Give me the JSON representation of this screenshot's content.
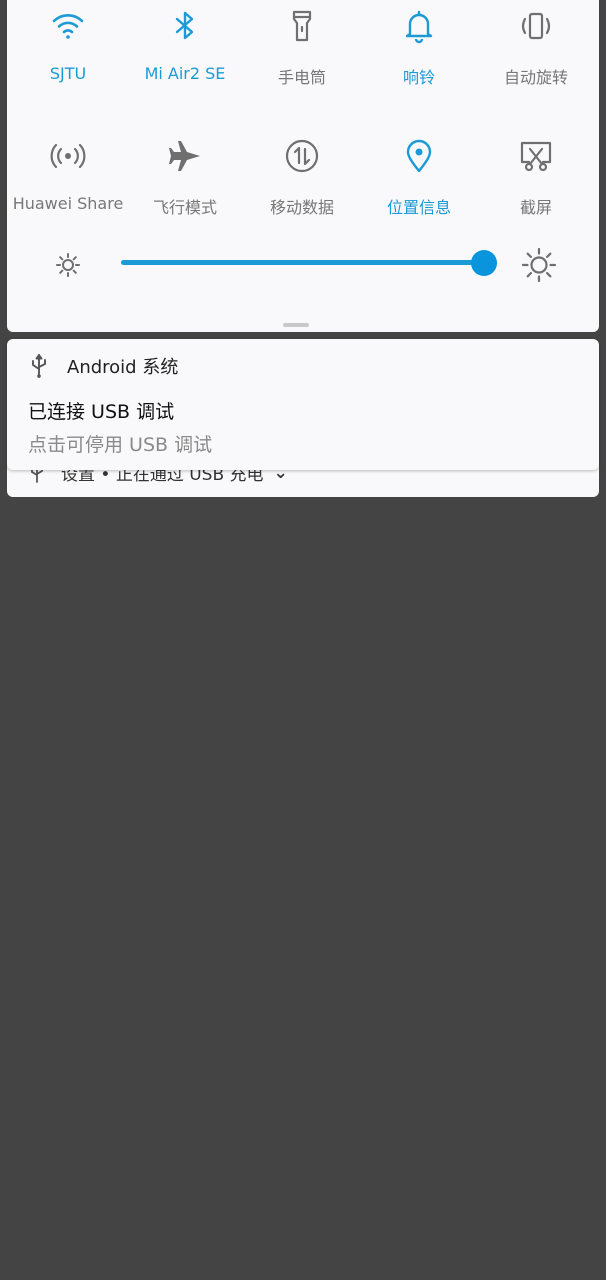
{
  "quick_settings": {
    "tiles": [
      {
        "id": "wifi",
        "label": "SJTU",
        "icon": "wifi-icon",
        "active": true
      },
      {
        "id": "bluetooth",
        "label": "Mi Air2 SE",
        "icon": "bluetooth-icon",
        "active": true
      },
      {
        "id": "flashlight",
        "label": "手电筒",
        "icon": "flashlight-icon",
        "active": false
      },
      {
        "id": "ring",
        "label": "响铃",
        "icon": "bell-icon",
        "active": true
      },
      {
        "id": "autorotate",
        "label": "自动旋转",
        "icon": "rotate-icon",
        "active": false
      },
      {
        "id": "huawei_share",
        "label": "Huawei Share",
        "icon": "share-icon",
        "active": false
      },
      {
        "id": "airplane",
        "label": "飞行模式",
        "icon": "airplane-icon",
        "active": false
      },
      {
        "id": "mobile_data",
        "label": "移动数据",
        "icon": "mobile-data-icon",
        "active": false
      },
      {
        "id": "location",
        "label": "位置信息",
        "icon": "location-icon",
        "active": true
      },
      {
        "id": "screenshot",
        "label": "截屏",
        "icon": "screenshot-icon",
        "active": false
      }
    ],
    "brightness_level": 0.97
  },
  "notification": {
    "app_name": "Android 系统",
    "title": "已连接 USB 调试",
    "text": "点击可停用 USB 调试",
    "icon": "usb-icon"
  },
  "notification_behind": {
    "text": "设置 • 正在通过 USB 充电",
    "icon": "usb-icon"
  },
  "colors": {
    "accent": "#1b9ad6",
    "inactive": "#777777",
    "panel": "#f9f9fb",
    "background": "#444444"
  }
}
